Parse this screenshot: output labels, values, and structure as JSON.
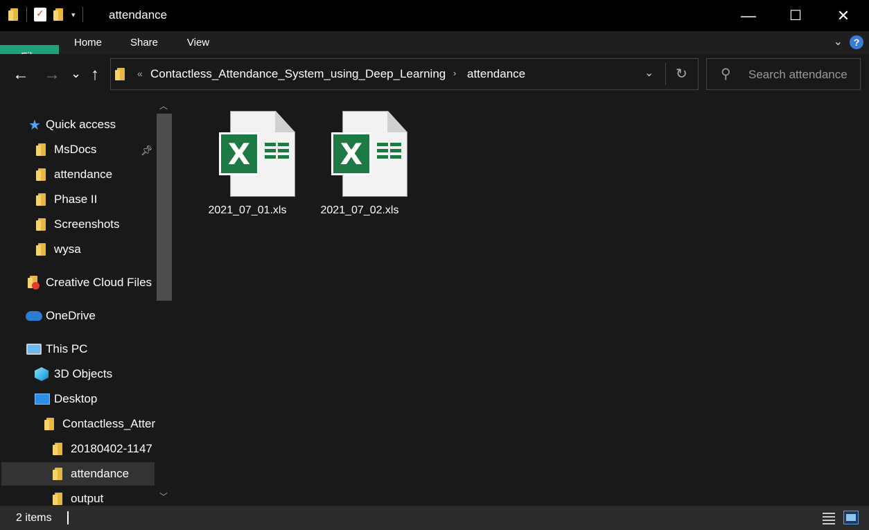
{
  "window": {
    "title": "attendance",
    "minimize_label": "—",
    "maximize_label": "☐",
    "close_label": "✕"
  },
  "ribbon": {
    "tabs": [
      {
        "label": "File"
      },
      {
        "label": "Home"
      },
      {
        "label": "Share"
      },
      {
        "label": "View"
      }
    ],
    "help_label": "?"
  },
  "navigation": {
    "back": "←",
    "forward": "→",
    "recent": "⌄",
    "up": "↑"
  },
  "address": {
    "overflow": "«",
    "breadcrumbs": [
      {
        "label": "Contactless_Attendance_System_using_Deep_Learning"
      },
      {
        "label": "attendance"
      }
    ],
    "separator": "›"
  },
  "search": {
    "placeholder": "Search attendance"
  },
  "sidebar": {
    "items": [
      {
        "label": "Quick access",
        "icon": "star-icon"
      },
      {
        "label": "MsDocs",
        "icon": "folder-icon",
        "pinned": true
      },
      {
        "label": "attendance",
        "icon": "folder-icon"
      },
      {
        "label": "Phase II",
        "icon": "folder-icon"
      },
      {
        "label": "Screenshots",
        "icon": "folder-icon"
      },
      {
        "label": "wysa",
        "icon": "folder-icon"
      },
      {
        "label": "Creative Cloud Files",
        "icon": "creative-cloud-folder-icon"
      },
      {
        "label": "OneDrive",
        "icon": "cloud-icon"
      },
      {
        "label": "This PC",
        "icon": "computer-icon"
      },
      {
        "label": "3D Objects",
        "icon": "cube-icon"
      },
      {
        "label": "Desktop",
        "icon": "desktop-icon"
      },
      {
        "label": "Contactless_Atter",
        "icon": "folder-icon"
      },
      {
        "label": "20180402-1147",
        "icon": "folder-icon"
      },
      {
        "label": "attendance",
        "icon": "folder-icon",
        "selected": true
      },
      {
        "label": "output",
        "icon": "folder-icon"
      }
    ]
  },
  "files": [
    {
      "name": "2021_07_01.xls",
      "icon": "excel-file-icon"
    },
    {
      "name": "2021_07_02.xls",
      "icon": "excel-file-icon"
    }
  ],
  "status": {
    "item_count": "2 items"
  },
  "colors": {
    "file_tab": "#1ca37c",
    "background": "#191919",
    "excel_green": "#1d7a45",
    "selection": "#333333"
  }
}
